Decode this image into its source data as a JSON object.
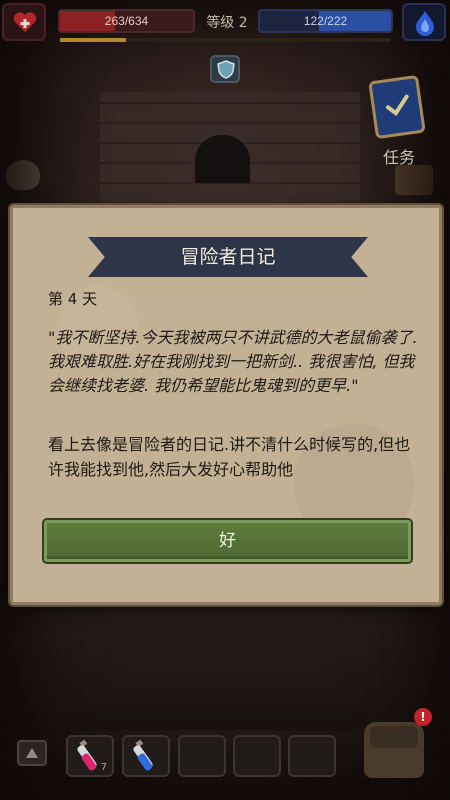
{
  "hud": {
    "hp_text": "263/634",
    "hp_fraction": 0.415,
    "level_text": "等级 2",
    "mp_text": "122/222",
    "mp_fraction": 0.55,
    "xp_fraction": 0.2,
    "hp_color": "#8c2126",
    "mp_color": "#2a4fa3"
  },
  "quest": {
    "label": "任务"
  },
  "dialog": {
    "title": "冒险者日记",
    "day": "第 4 天",
    "quote": "\"我不断坚持.今天我被两只不讲武德的大老鼠偷袭了.我艰难取胜.好在我刚找到一把新剑.. 我很害怕, 但我会继续找老婆. 我仍希望能比鬼魂到的更早.\"",
    "comment": "看上去像是冒险者的日记.讲不清什么时候写的,但也许我能找到他,然后大发好心帮助他",
    "ok_label": "好"
  },
  "inventory": {
    "slots": [
      {
        "item": "red-potion",
        "count": "7"
      },
      {
        "item": "blue-potion",
        "count": ""
      },
      {
        "item": "",
        "count": ""
      },
      {
        "item": "",
        "count": ""
      },
      {
        "item": "",
        "count": ""
      }
    ],
    "alert_badge": "!"
  }
}
